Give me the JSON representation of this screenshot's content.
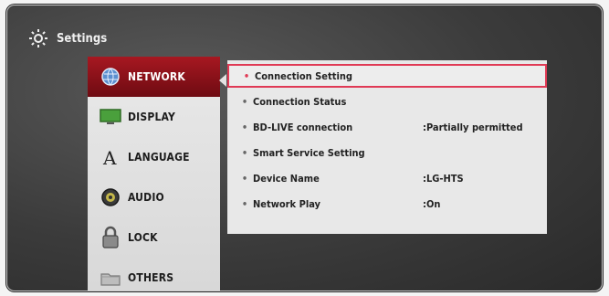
{
  "window": {
    "title": "Settings"
  },
  "icons": {
    "settings": "gear-icon"
  },
  "sidebar": {
    "items": [
      {
        "label": "NETWORK",
        "icon": "globe-icon",
        "active": true
      },
      {
        "label": "DISPLAY",
        "icon": "monitor-icon",
        "active": false
      },
      {
        "label": "LANGUAGE",
        "icon": "letter-a-icon",
        "active": false
      },
      {
        "label": "AUDIO",
        "icon": "speaker-icon",
        "active": false
      },
      {
        "label": "LOCK",
        "icon": "padlock-icon",
        "active": false
      },
      {
        "label": "OTHERS",
        "icon": "folder-icon",
        "active": false
      }
    ]
  },
  "network": {
    "rows": [
      {
        "label": "Connection Setting",
        "value": "",
        "selected": true
      },
      {
        "label": "Connection Status",
        "value": ""
      },
      {
        "label": "BD-LIVE connection",
        "value": ":Partially permitted"
      },
      {
        "label": "Smart Service Setting",
        "value": ""
      },
      {
        "label": "Device Name",
        "value": ":LG-HTS"
      },
      {
        "label": "Network Play",
        "value": ":On"
      }
    ],
    "bullet": "•"
  },
  "colors": {
    "accent": "#a71821",
    "highlight_border": "#e03a55",
    "panel": "#e8e8e8"
  }
}
